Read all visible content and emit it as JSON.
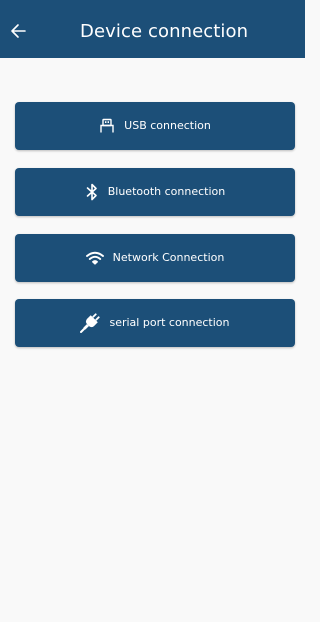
{
  "appbar": {
    "title": "Device connection",
    "back_icon": "arrow-left-icon"
  },
  "colors": {
    "primary": "#1c4f78",
    "background": "#f9f9f9",
    "on_primary": "#ffffff"
  },
  "connections": [
    {
      "label": "USB connection",
      "icon": "usb-icon"
    },
    {
      "label": "Bluetooth connection",
      "icon": "bluetooth-icon"
    },
    {
      "label": "Network Connection",
      "icon": "wifi-icon"
    },
    {
      "label": "serial port connection",
      "icon": "plug-icon"
    }
  ]
}
